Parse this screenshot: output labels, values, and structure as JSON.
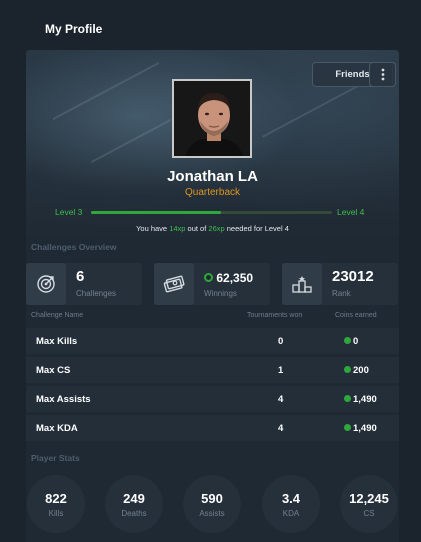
{
  "header": {
    "title": "My Profile"
  },
  "hero": {
    "friends_label": "Friends",
    "more_icon": "vertical-dots-icon",
    "name": "Jonathan LA",
    "role": "Quarterback",
    "level_current": "Level 3",
    "level_next": "Level 4",
    "xp_progress_percent": 54,
    "xp_note": {
      "prefix": "You have",
      "have": "14xp",
      "middle": "out of",
      "needed": "26xp",
      "suffix": "needed for Level 4"
    }
  },
  "challenges_overview": {
    "title": "Challenges Overview",
    "stats": [
      {
        "icon": "target-icon",
        "value": "6",
        "label": "Challenges"
      },
      {
        "icon": "cash-icon",
        "value": "62,350",
        "label": "Winnings",
        "coin": true
      },
      {
        "icon": "podium-icon",
        "value": "23012",
        "label": "Rank"
      }
    ]
  },
  "challenge_table": {
    "columns": [
      "Challenge Name",
      "Tournaments won",
      "Coins earned"
    ],
    "rows": [
      {
        "name": "Max Kills",
        "won": "0",
        "coins": "0"
      },
      {
        "name": "Max CS",
        "won": "1",
        "coins": "200"
      },
      {
        "name": "Max Assists",
        "won": "4",
        "coins": "1,490"
      },
      {
        "name": "Max KDA",
        "won": "4",
        "coins": "1,490"
      }
    ]
  },
  "player_stats": {
    "title": "Player Stats",
    "items": [
      {
        "value": "822",
        "label": "Kills"
      },
      {
        "value": "249",
        "label": "Deaths"
      },
      {
        "value": "590",
        "label": "Assists"
      },
      {
        "value": "3.4",
        "label": "KDA"
      },
      {
        "value": "12,245",
        "label": "CS"
      }
    ]
  },
  "colors": {
    "accent_green": "#2fa83b",
    "role_orange": "#e0961e",
    "background": "#1b232c"
  }
}
